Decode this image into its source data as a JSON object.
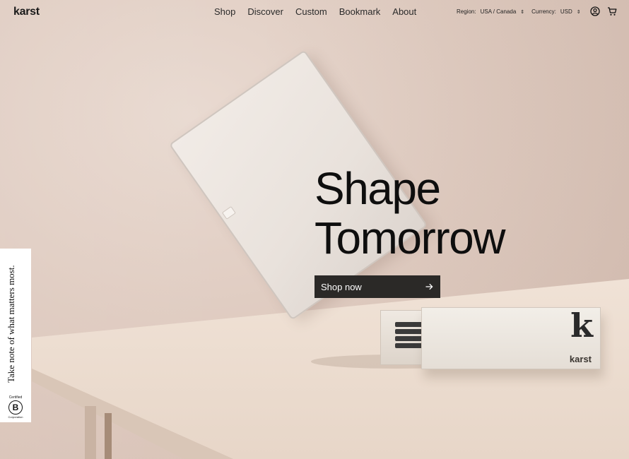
{
  "header": {
    "logo": "karst",
    "nav": [
      "Shop",
      "Discover",
      "Custom",
      "Bookmark",
      "About"
    ],
    "region_label": "Region:",
    "region_value": "USA / Canada",
    "currency_label": "Currency:",
    "currency_value": "USD",
    "icons": [
      "account-icon",
      "cart-icon"
    ]
  },
  "hero": {
    "headline_line1": "Shape",
    "headline_line2": "Tomorrow",
    "cta_label": "Shop now",
    "cta_icon": "arrow-right-icon",
    "product_box": {
      "mark": "k",
      "brand": "karst"
    }
  },
  "side_tab": {
    "text": "Take note of what matters most.",
    "badge_top": "Certified",
    "badge_letter": "B",
    "badge_bottom": "Corporation"
  },
  "colors": {
    "background": "#dcc8bd",
    "cta_bg": "#2b2927",
    "text": "#0e0e0e"
  }
}
